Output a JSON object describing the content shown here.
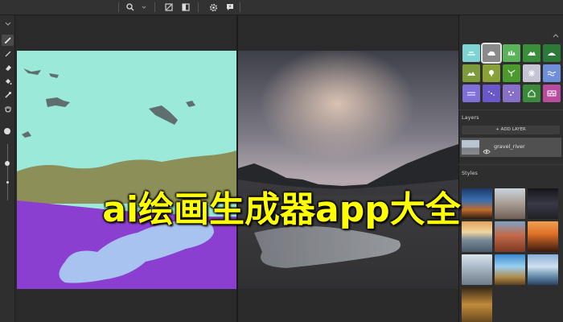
{
  "overlay": {
    "title": "ai绘画生成器app大全"
  },
  "toolbar": {
    "icons": [
      "search-icon",
      "compare-icon",
      "split-view-icon",
      "gear-icon",
      "feedback-icon"
    ]
  },
  "tools": [
    "pen-icon",
    "line-icon",
    "eraser-icon",
    "fill-bucket-icon",
    "eyedropper-icon",
    "hand-icon"
  ],
  "panel": {
    "layers": {
      "title": "Layers",
      "add_button": "+ ADD LAYER",
      "items": [
        {
          "name": "gravel_river",
          "visible": true
        }
      ]
    },
    "styles": {
      "title": "Styles"
    },
    "materials": [
      {
        "icon": "sky-icon",
        "color": "#7fd3d3"
      },
      {
        "icon": "cloud-icon",
        "color": "#8a8a8a",
        "selected": true
      },
      {
        "icon": "grass-icon",
        "color": "#5ab35a"
      },
      {
        "icon": "mountain-icon",
        "color": "#3b8f3b"
      },
      {
        "icon": "hill-icon",
        "color": "#2c7a3a"
      },
      {
        "icon": "field-icon",
        "color": "#7d9a3c"
      },
      {
        "icon": "tree-icon",
        "color": "#8aa03a"
      },
      {
        "icon": "plant-icon",
        "color": "#4c9a2e"
      },
      {
        "icon": "snow-icon",
        "color": "#c4c4d4"
      },
      {
        "icon": "water-icon",
        "color": "#6f8fd8"
      },
      {
        "icon": "river-icon",
        "color": "#7f6fd8"
      },
      {
        "icon": "fog-icon",
        "color": "#6a57c8"
      },
      {
        "icon": "stone-icon",
        "color": "#8870c8"
      },
      {
        "icon": "house-icon",
        "color": "#3b8a3b"
      },
      {
        "icon": "wall-icon",
        "color": "#b84da0"
      }
    ]
  }
}
